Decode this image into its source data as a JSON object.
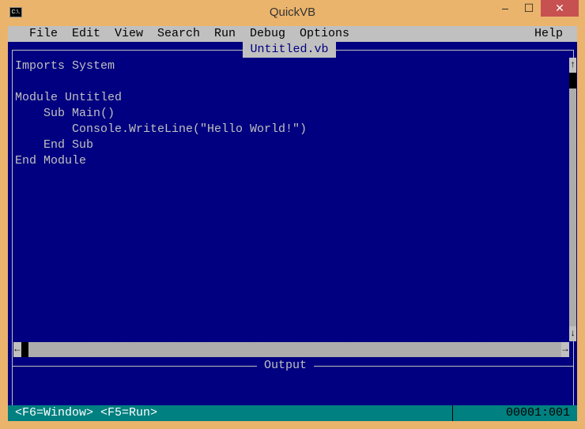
{
  "window": {
    "title": "QuickVB",
    "icon": "console-icon",
    "icon_text": "C:\\."
  },
  "menu": [
    "File",
    "Edit",
    "View",
    "Search",
    "Run",
    "Debug",
    "Options",
    "Help"
  ],
  "editor": {
    "tab_title": "Untitled.vb",
    "lines": [
      "Imports System",
      "",
      "Module Untitled",
      "    Sub Main()",
      "        Console.WriteLine(\"Hello World!\")",
      "    End Sub",
      "End Module"
    ]
  },
  "output": {
    "title": "Output"
  },
  "status": {
    "hints": "<F6=Window> <F5=Run>",
    "position": "00001:001"
  },
  "colors": {
    "background": "#000080",
    "menu": "#C0C0C0",
    "status": "#008080",
    "frame": "#EBB46C"
  }
}
